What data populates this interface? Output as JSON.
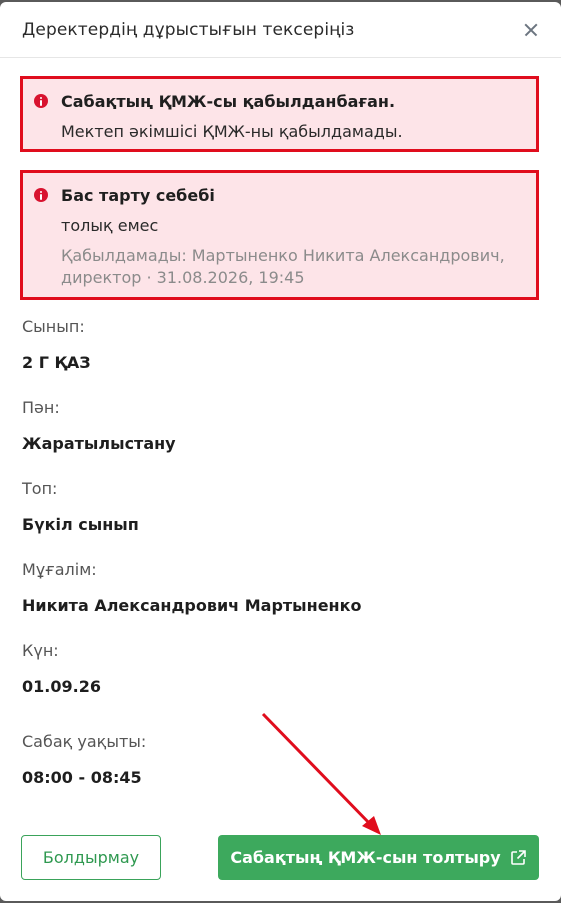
{
  "modal": {
    "title": "Деректердің дұрыстығын тексеріңіз"
  },
  "alerts": [
    {
      "title": "Сабақтың ҚМЖ-сы қабылданбаған.",
      "text": "Мектеп әкімшісі ҚМЖ-ны қабылдамады."
    },
    {
      "title": "Бас тарту себебі",
      "text": "толық емес",
      "meta_line1": "Қабылдамады: Мартыненко Никита Александрович,",
      "meta_line2": "директор · 31.08.2026, 19:45"
    }
  ],
  "fields": [
    {
      "label": "Сынып:",
      "value": "2 Г ҚАЗ"
    },
    {
      "label": "Пән:",
      "value": "Жаратылыстану"
    },
    {
      "label": "Топ:",
      "value": "Бүкіл сынып"
    },
    {
      "label": "Мұғалім:",
      "value": "Никита Александрович Мартыненко"
    },
    {
      "label": "Күн:",
      "value": "01.09.26"
    },
    {
      "label": "Сабақ уақыты:",
      "value": "08:00 - 08:45"
    }
  ],
  "buttons": {
    "cancel": "Болдырмау",
    "primary": "Сабақтың ҚМЖ-сын толтыру"
  },
  "icons": {
    "close": "close-icon",
    "info": "info-icon",
    "external": "external-link-icon"
  },
  "colors": {
    "alert_bg": "#fde4e8",
    "alert_border": "#e00d1d",
    "primary": "#3da95d",
    "annotation_arrow": "#e00d1d"
  }
}
